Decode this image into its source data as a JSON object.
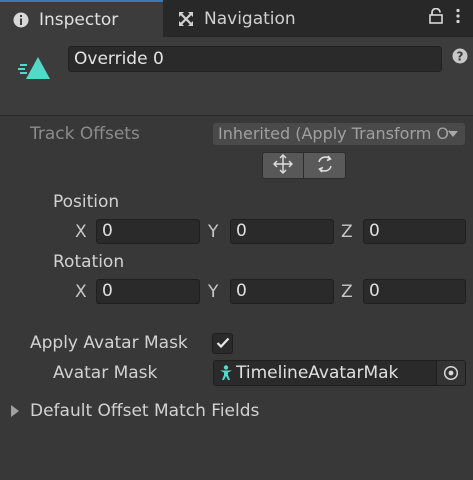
{
  "tabs": [
    {
      "label": "Inspector",
      "icon": "info-icon",
      "active": true
    },
    {
      "label": "Navigation",
      "icon": "navigation-icon",
      "active": false
    }
  ],
  "toolbar": {
    "icons": [
      "lock-icon",
      "kebab-menu-icon"
    ]
  },
  "header": {
    "track_icon": "override-track-icon",
    "name": "Override 0",
    "help_icon": "help-icon"
  },
  "track_offsets": {
    "label": "Track Offsets",
    "value": "Inherited (Apply Transform Offsets)",
    "buttons": [
      "move-offset-icon",
      "rotate-offset-icon"
    ]
  },
  "position": {
    "label": "Position",
    "x_label": "X",
    "x": "0",
    "y_label": "Y",
    "y": "0",
    "z_label": "Z",
    "z": "0"
  },
  "rotation": {
    "label": "Rotation",
    "x_label": "X",
    "x": "0",
    "y_label": "Y",
    "y": "0",
    "z_label": "Z",
    "z": "0"
  },
  "apply_avatar_mask": {
    "label": "Apply Avatar Mask",
    "checked": true
  },
  "avatar_mask": {
    "label": "Avatar Mask",
    "value": "TimelineAvatarMak",
    "icon": "avatar-mask-icon",
    "picker_icon": "object-picker-icon"
  },
  "default_offset": {
    "label": "Default Offset Match Fields",
    "expanded": false
  },
  "colors": {
    "accent": "#3a79bb",
    "track_icon": "#52d9c8",
    "background": "#383838"
  }
}
